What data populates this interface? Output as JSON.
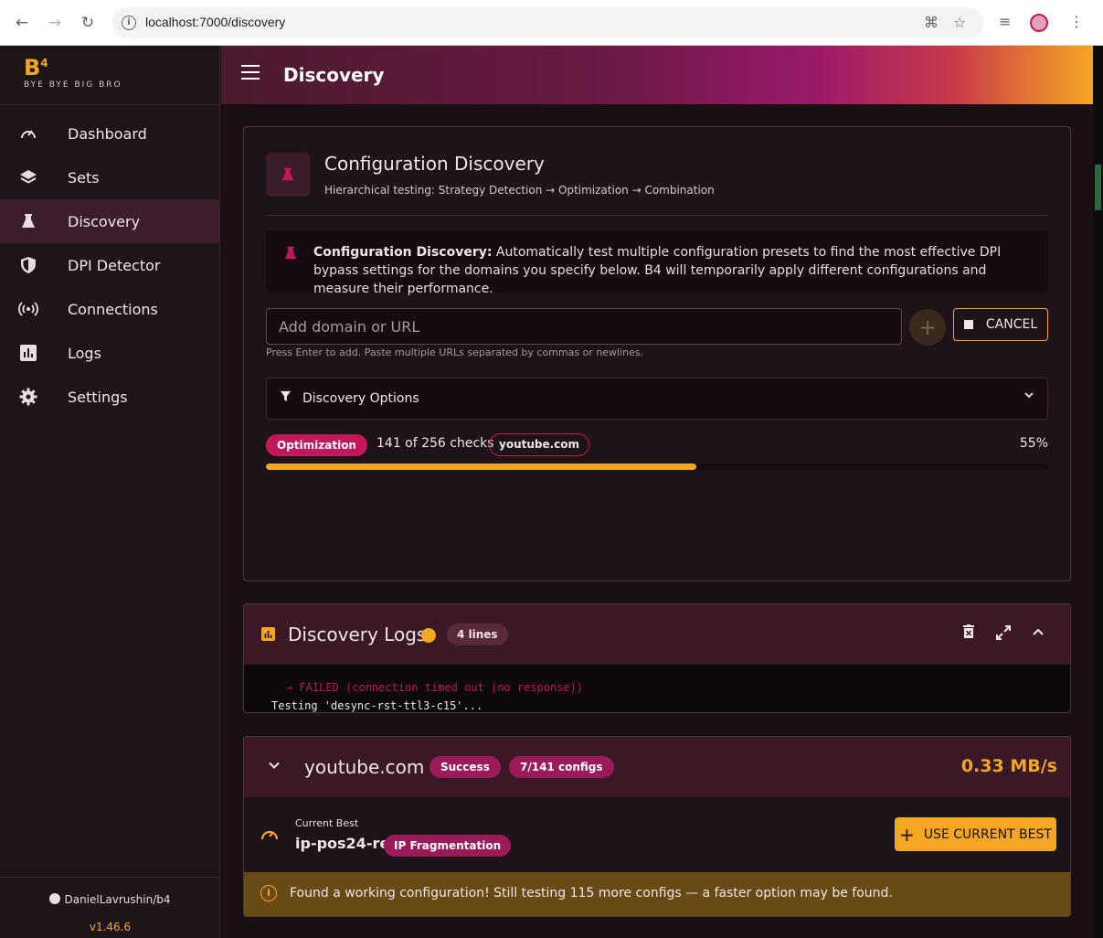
{
  "browser": {
    "url": "localhost:7000/discovery"
  },
  "sidebar": {
    "logo_text": "B",
    "logo_super": "4",
    "tagline": "BYE BYE BIG BRO",
    "items": [
      {
        "label": "Dashboard",
        "icon": "speedometer-icon"
      },
      {
        "label": "Sets",
        "icon": "layers-icon"
      },
      {
        "label": "Discovery",
        "icon": "flask-icon"
      },
      {
        "label": "DPI Detector",
        "icon": "shield-icon"
      },
      {
        "label": "Connections",
        "icon": "broadcast-icon"
      },
      {
        "label": "Logs",
        "icon": "bar-chart-icon"
      },
      {
        "label": "Settings",
        "icon": "gear-icon"
      }
    ],
    "active_item": "Discovery",
    "repo": "DanielLavrushin/b4",
    "version": "v1.46.6"
  },
  "appbar": {
    "title": "Discovery"
  },
  "discovery_card": {
    "title": "Configuration Discovery",
    "subtitle": "Hierarchical testing: Strategy Detection → Optimization → Combination",
    "info_bold": "Configuration Discovery:",
    "info_text": " Automatically test multiple configuration presets to find the most effective DPI bypass settings for the domains you specify below. B4 will temporarily apply different configurations and measure their performance.",
    "input_placeholder": "Add domain or URL",
    "add_label": "+",
    "cancel_label": "CANCEL",
    "hint": "Press Enter to add. Paste multiple URLs separated by commas or newlines.",
    "options_label": "Discovery Options",
    "phase": "Optimization",
    "checks": "141 of 256 checks",
    "current_domain": "youtube.com",
    "progress_percent": 55,
    "progress_label": "55%"
  },
  "logs": {
    "title": "Discovery Logs",
    "count": "4 lines",
    "lines": [
      "→ FAILED (connection timed out (no response))",
      "Testing 'desync-rst-ttl3-c15'..."
    ]
  },
  "result": {
    "domain": "youtube.com",
    "status": "Success",
    "configs": "7/141 configs",
    "speed": "0.33 MB/s",
    "best_label": "Current Best",
    "best_name": "ip-pos24-rev",
    "best_tag": "IP Fragmentation",
    "use_label": "USE CURRENT BEST",
    "alert": "Found a working configuration! Still testing 115 more configs — a faster option may be found."
  },
  "colors": {
    "accent": "#f5a623",
    "brand": "#c2185b"
  }
}
